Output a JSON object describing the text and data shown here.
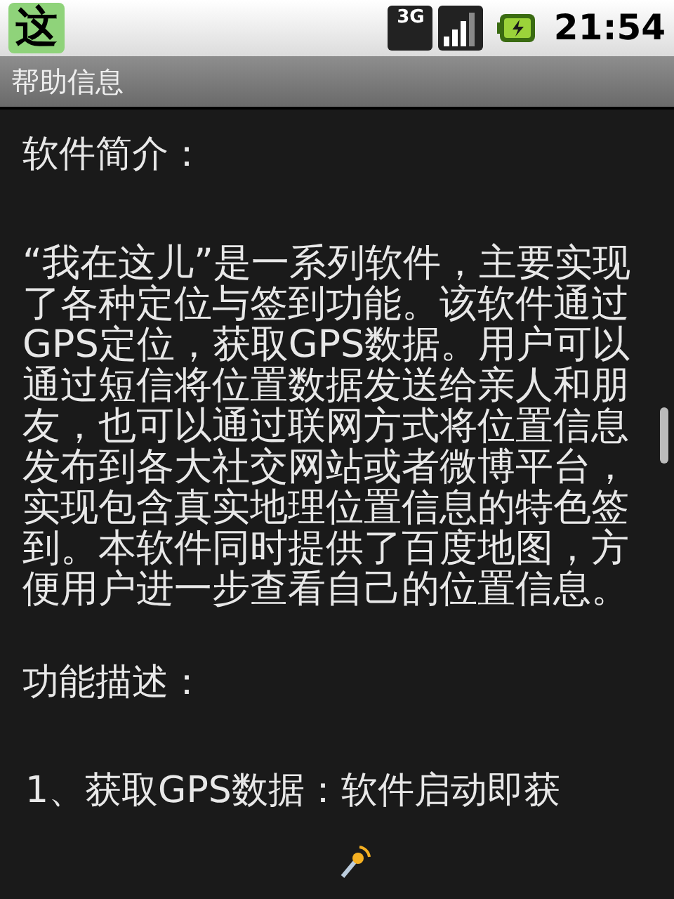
{
  "status_bar": {
    "notification_glyph": "这",
    "network_label": "3G",
    "time": "21:54"
  },
  "title_bar": {
    "title": "帮助信息"
  },
  "content": [
    {
      "kind": "heading",
      "text": "软件简介："
    },
    {
      "kind": "paragraph",
      "text": "“我在这儿”是一系列软件，主要实现了各种定位与签到功能。该软件通过GPS定位，获取GPS数据。用户可以通过短信将位置数据发送给亲人和朋友，也可以通过联网方式将位置信息发布到各大社交网站或者微博平台，实现包含真实地理位置信息的特色签到。本软件同时提供了百度地图，方便用户进一步查看自己的位置信息。"
    },
    {
      "kind": "heading",
      "text": "功能描述："
    },
    {
      "kind": "list_item",
      "text": "1、获取GPS数据：软件启动即获"
    }
  ]
}
